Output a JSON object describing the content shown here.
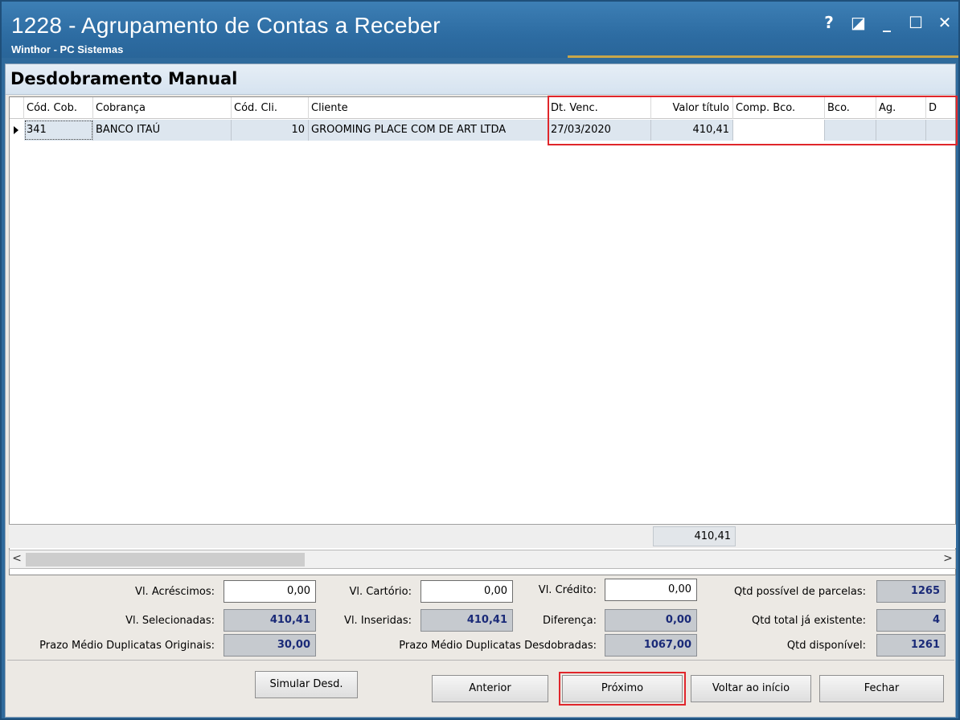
{
  "window": {
    "title": "1228 - Agrupamento de Contas a Receber",
    "subtitle": "Winthor - PC Sistemas",
    "buttons": {
      "help": "?",
      "restore": "◪",
      "minimize": "_",
      "maximize": "☐",
      "close": "✕"
    }
  },
  "section": {
    "title": "Desdobramento Manual"
  },
  "grid": {
    "columns": [
      "Cód. Cob.",
      "Cobrança",
      "Cód. Cli.",
      "Cliente",
      "Dt. Venc.",
      "Valor título",
      "Comp. Bco.",
      "Bco.",
      "Ag.",
      "D"
    ],
    "rows": [
      {
        "cod_cob": "341",
        "cobranca": "BANCO ITAÚ",
        "cod_cli": "10",
        "cliente": "GROOMING PLACE COM DE ART LTDA",
        "dt_venc": "27/03/2020",
        "valor_titulo": "410,41",
        "comp_bco": "",
        "bco": "",
        "ag": "",
        "d": ""
      }
    ],
    "footer_total": "410,41",
    "scroll_left": "<",
    "scroll_right": ">"
  },
  "form": {
    "acrescimos": {
      "label": "Vl. Acréscimos:",
      "value": "0,00"
    },
    "cartorio": {
      "label": "Vl. Cartório:",
      "value": "0,00"
    },
    "credito": {
      "label": "Vl. Crédito:",
      "value": "0,00"
    },
    "qtd_possivel": {
      "label": "Qtd possível de parcelas:",
      "value": "1265"
    },
    "selecionadas": {
      "label": "Vl. Selecionadas:",
      "value": "410,41"
    },
    "inseridas": {
      "label": "Vl. Inseridas:",
      "value": "410,41"
    },
    "diferenca": {
      "label": "Diferença:",
      "value": "0,00"
    },
    "qtd_existente": {
      "label": "Qtd total já existente:",
      "value": "4"
    },
    "prazo_originais": {
      "label": "Prazo Médio Duplicatas Originais:",
      "value": "30,00"
    },
    "prazo_desdobradas": {
      "label": "Prazo Médio Duplicatas Desdobradas:",
      "value": "1067,00"
    },
    "qtd_disponivel": {
      "label": "Qtd disponível:",
      "value": "1261"
    }
  },
  "buttons": {
    "simular": "Simular Desd.",
    "anterior": "Anterior",
    "proximo": "Próximo",
    "voltar": "Voltar ao início",
    "fechar": "Fechar"
  },
  "colors": {
    "highlight": "#e0262b",
    "row_selected": "#dde6ef",
    "readonly_value": "#1a2a78"
  }
}
